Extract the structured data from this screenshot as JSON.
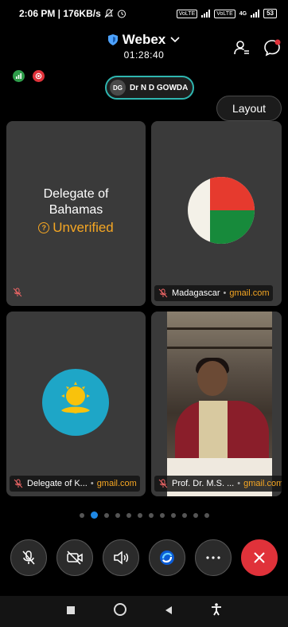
{
  "status_bar": {
    "time_speed": "2:06 PM | 176KB/s",
    "battery": "53",
    "network": "4G",
    "sim_label": "VoLTE"
  },
  "header": {
    "app_name": "Webex",
    "timer": "01:28:40"
  },
  "active_speaker": {
    "initials": "DG",
    "name": "Dr N D GOWDA"
  },
  "layout_button": {
    "label": "Layout"
  },
  "tiles": [
    {
      "line1": "Delegate of",
      "line2": "Bahamas",
      "status": "Unverified"
    },
    {
      "name": "Madagascar",
      "domain": "gmail.com",
      "sep": "•"
    },
    {
      "name": "Delegate of K...",
      "domain": "gmail.com",
      "sep": "•"
    },
    {
      "name": "Prof. Dr. M.S. ...",
      "domain": "gmail.com",
      "sep": "•"
    }
  ],
  "pager": {
    "total": 12,
    "active_index": 1
  },
  "colors": {
    "accent": "#1e88e5",
    "end_call": "#e0323a",
    "domain_text": "#f5a623",
    "speaker_ring": "#2fb6b0"
  }
}
